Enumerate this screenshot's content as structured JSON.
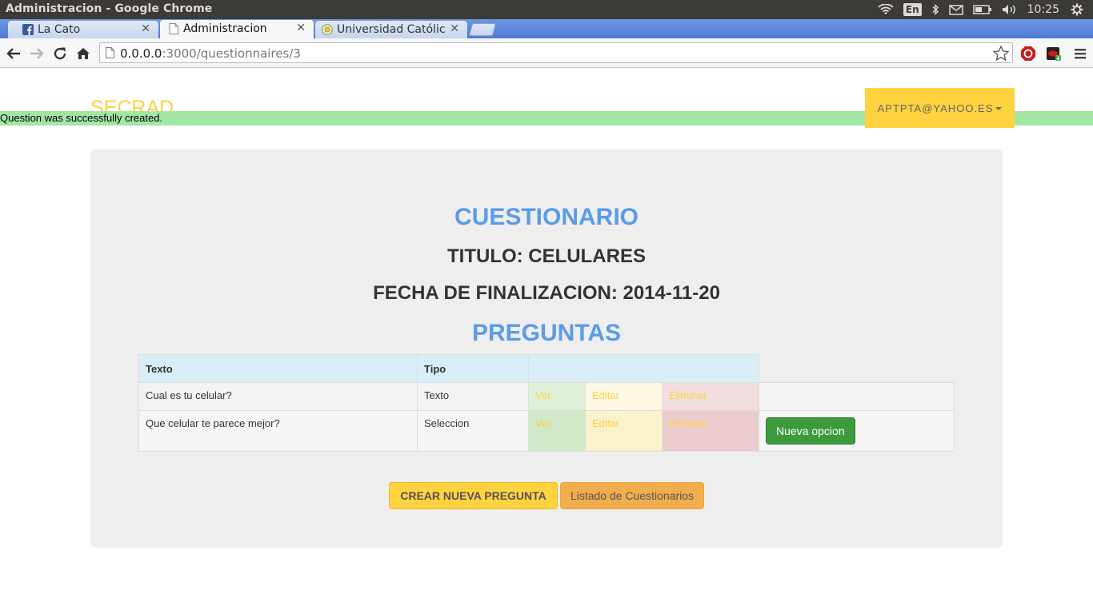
{
  "os": {
    "window_title": "Administracion - Google Chrome",
    "keyboard_layout": "En",
    "clock": "10:25"
  },
  "browser": {
    "tabs": [
      {
        "label": "La Cato",
        "favicon": "facebook-icon"
      },
      {
        "label": "Administracion",
        "favicon": "page-icon"
      },
      {
        "label": "Universidad Católica",
        "favicon": "globe-icon"
      }
    ],
    "url_host": "0.0.0.0",
    "url_rest": ":3000/questionnaires/3"
  },
  "nav": {
    "brand": "SECRAD",
    "user_email": "APTPTA@YAHOO.ES"
  },
  "notice": "Question was successfully created.",
  "main": {
    "heading": "CUESTIONARIO",
    "title_line": "TITULO: CELULARES",
    "date_line": "FECHA DE FINALIZACION: 2014-11-20",
    "questions_heading": "PREGUNTAS",
    "table": {
      "headers": [
        "Texto",
        "Tipo"
      ],
      "rows": [
        {
          "texto": "Cual es tu celular?",
          "tipo": "Texto",
          "ver": "Ver",
          "editar": "Editar",
          "eliminar": "Eliminar",
          "opcion": ""
        },
        {
          "texto": "Que celular te parece mejor?",
          "tipo": "Seleccion",
          "ver": "Ver",
          "editar": "Editar",
          "eliminar": "Eliminar",
          "opcion": "Nueva opcion"
        }
      ]
    },
    "create_button": "CREAR NUEVA PREGUNTA",
    "list_button": "Listado de Cuestionarios"
  },
  "colors": {
    "brand": "#ffd23f",
    "heading_blue": "#5b9be8",
    "notice_green": "#a3e6a3",
    "success_button": "#3d9b3d",
    "warning_button": "#f0ad4e"
  }
}
